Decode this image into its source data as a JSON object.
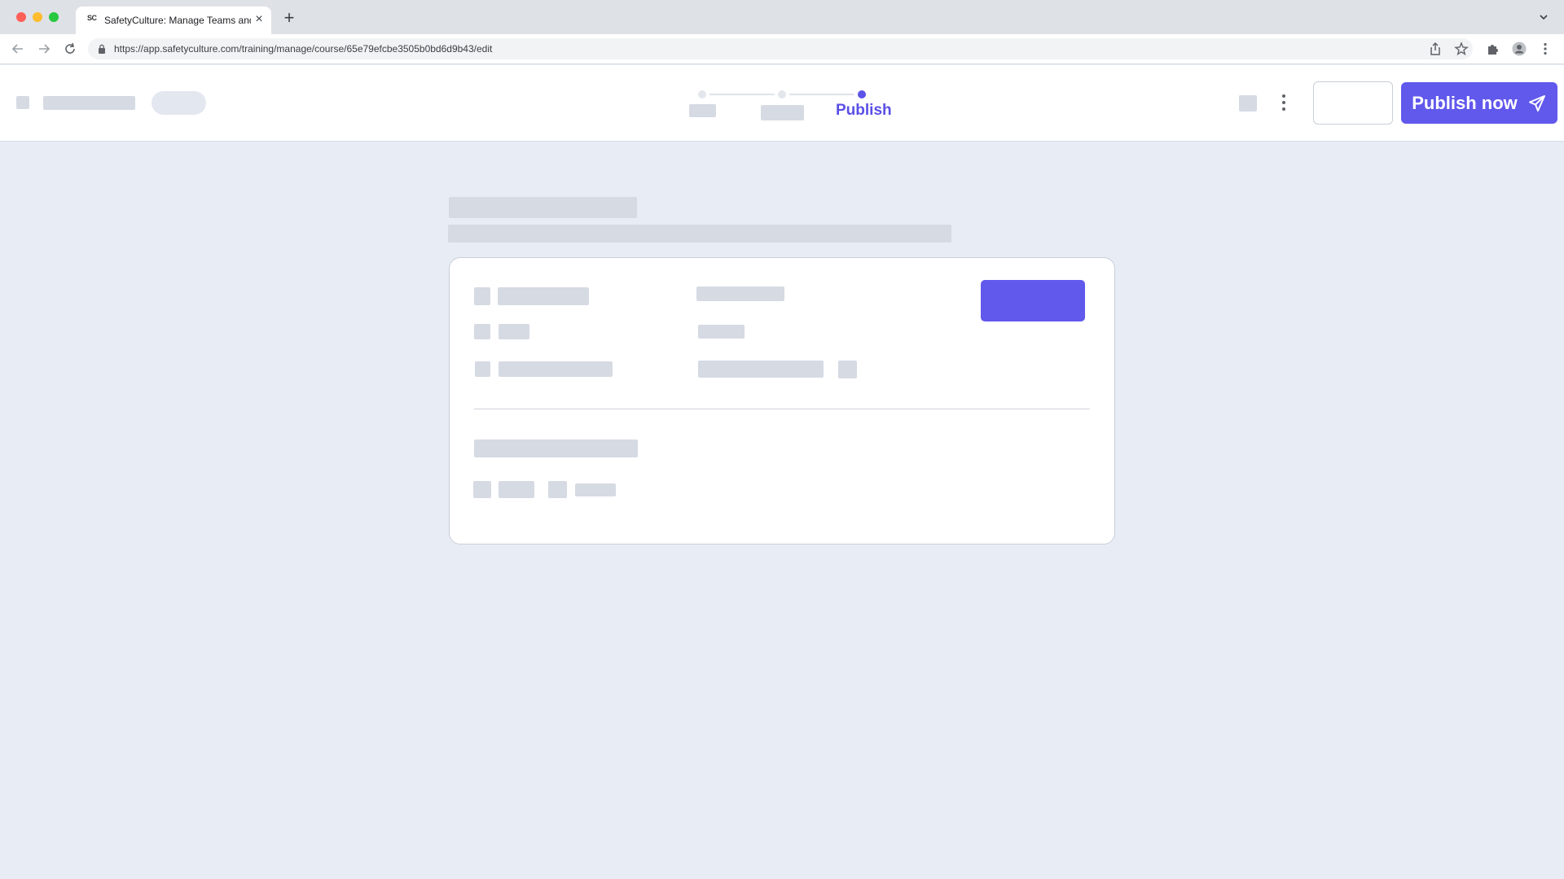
{
  "browser": {
    "tab_title": "SafetyCulture: Manage Teams and ...",
    "tab_favicon": "SC",
    "url": "https://app.safetyculture.com/training/manage/course/65e79efcbe3505b0bd6d9b43/edit",
    "icons": [
      "back-icon",
      "forward-icon",
      "reload-icon",
      "lock-icon",
      "share-icon",
      "star-icon",
      "extensions-icon",
      "profile-icon",
      "chrome-menu-icon",
      "tab-list-icon",
      "new-tab-icon",
      "close-icon"
    ]
  },
  "header": {
    "stepper": {
      "active_step_label": "Publish",
      "steps_total": 3,
      "active_step_index": 3
    },
    "publish_button_label": "Publish now",
    "publish_icon": "send-icon",
    "more_icon": "more-vertical-icon"
  },
  "colors": {
    "accent": "#6158ec",
    "page_background": "#e8ecf5",
    "skeleton": "#d5dae3"
  }
}
